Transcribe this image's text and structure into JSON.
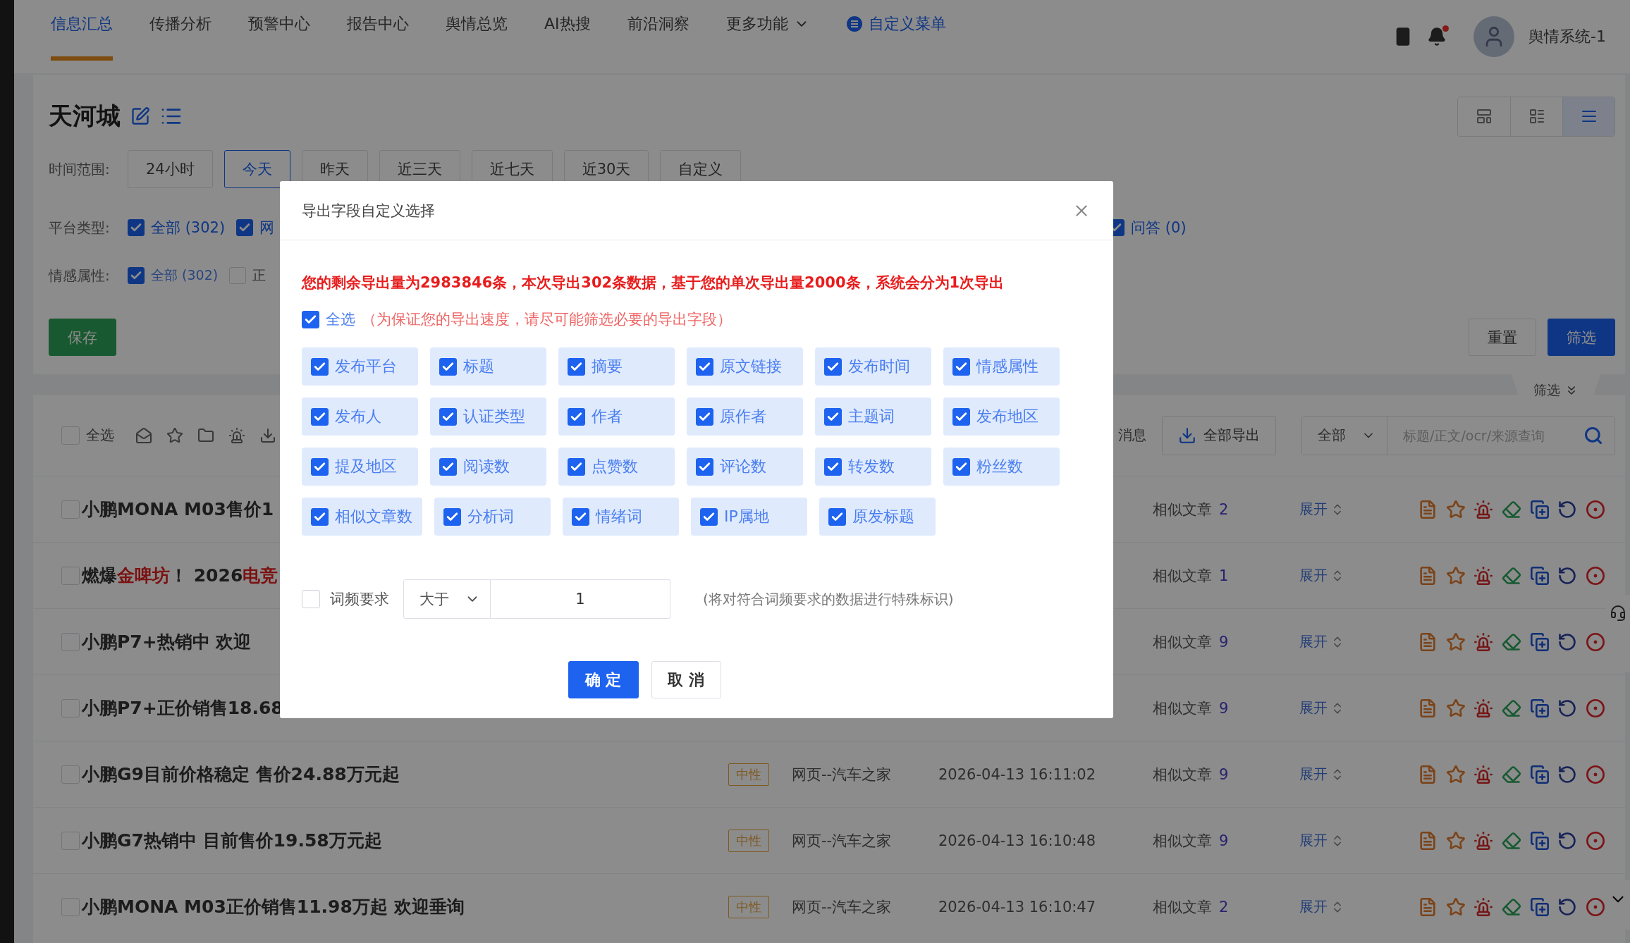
{
  "nav": {
    "items": [
      {
        "label": "信息汇总",
        "selected": true,
        "kind": "plain"
      },
      {
        "label": "传播分析",
        "selected": false,
        "kind": "plain"
      },
      {
        "label": "预警中心",
        "selected": false,
        "kind": "plain"
      },
      {
        "label": "报告中心",
        "selected": false,
        "kind": "plain"
      },
      {
        "label": "舆情总览",
        "selected": false,
        "kind": "plain"
      },
      {
        "label": "AI热搜",
        "selected": false,
        "kind": "plain"
      },
      {
        "label": "前沿洞察",
        "selected": false,
        "kind": "plain"
      },
      {
        "label": "更多功能",
        "selected": false,
        "kind": "dropdown"
      },
      {
        "label": "自定义菜单",
        "selected": false,
        "kind": "custom"
      }
    ],
    "notifications": {
      "unread": true
    },
    "user": {
      "name": "舆情系统-1"
    }
  },
  "header": {
    "title": "天河城",
    "views": [
      {
        "selected": false
      },
      {
        "selected": false
      },
      {
        "selected": true
      }
    ]
  },
  "time_range": {
    "label": "时间范围:",
    "options": [
      {
        "label": "24小时",
        "selected": false
      },
      {
        "label": "今天",
        "selected": true
      },
      {
        "label": "昨天",
        "selected": false
      },
      {
        "label": "近三天",
        "selected": false
      },
      {
        "label": "近七天",
        "selected": false
      },
      {
        "label": "近30天",
        "selected": false
      },
      {
        "label": "自定义",
        "selected": false
      }
    ]
  },
  "platform": {
    "label": "平台类型:",
    "items": [
      {
        "label": "全部 (302)",
        "checked": true
      },
      {
        "label": "网",
        "checked": true
      },
      {
        "label": "问答 (0)",
        "checked": true
      }
    ]
  },
  "sentiment": {
    "label": "情感属性:",
    "items": [
      {
        "label": "全部 (302)",
        "checked": true
      },
      {
        "label": "正",
        "checked": false
      }
    ]
  },
  "actions": {
    "save": "保存",
    "reset": "重置",
    "filter": "筛选"
  },
  "collapse_tab": {
    "label": "筛选"
  },
  "list_toolbar": {
    "select_all": {
      "label": "全选",
      "checked": false
    },
    "message": "消息",
    "export_all": "全部导出",
    "scope": {
      "value": "全部"
    },
    "search": {
      "placeholder": "标题/正文/ocr/来源查询"
    }
  },
  "rows": [
    {
      "checked": false,
      "title_parts": [
        {
          "text": "小鹏MONA M03售价1",
          "highlight": false
        }
      ],
      "similar_label": "相似文章",
      "similar_count": "2",
      "expand": "展开"
    },
    {
      "checked": false,
      "title_parts": [
        {
          "text": "燃爆",
          "highlight": false
        },
        {
          "text": "金啤坊",
          "highlight": true
        },
        {
          "text": "！ 2026",
          "highlight": false
        },
        {
          "text": "电竞",
          "highlight": true
        }
      ],
      "similar_label": "相似文章",
      "similar_count": "1",
      "expand": "展开"
    },
    {
      "checked": false,
      "title_parts": [
        {
          "text": "小鹏P7+热销中 欢迎",
          "highlight": false
        }
      ],
      "similar_label": "相似文章",
      "similar_count": "9",
      "expand": "展开"
    },
    {
      "checked": false,
      "title_parts": [
        {
          "text": "小鹏P7+正价销售18.68",
          "highlight": false
        }
      ],
      "similar_label": "相似文章",
      "similar_count": "9",
      "expand": "展开"
    },
    {
      "checked": false,
      "title_parts": [
        {
          "text": "小鹏G9目前价格稳定 售价24.88万元起",
          "highlight": false
        }
      ],
      "tag": "中性",
      "source": "网页--汽车之家",
      "time": "2026-04-13 16:11:02",
      "similar_label": "相似文章",
      "similar_count": "9",
      "expand": "展开"
    },
    {
      "checked": false,
      "title_parts": [
        {
          "text": "小鹏G7热销中 目前售价19.58万元起",
          "highlight": false
        }
      ],
      "tag": "中性",
      "source": "网页--汽车之家",
      "time": "2026-04-13 16:10:48",
      "similar_label": "相似文章",
      "similar_count": "9",
      "expand": "展开"
    },
    {
      "checked": false,
      "title_parts": [
        {
          "text": "小鹏MONA M03正价销售11.98万起 欢迎垂询",
          "highlight": false
        }
      ],
      "tag": "中性",
      "source": "网页--汽车之家",
      "time": "2026-04-13 16:10:47",
      "similar_label": "相似文章",
      "similar_count": "2",
      "expand": "展开"
    }
  ],
  "modal": {
    "title": "导出字段自定义选择",
    "warning": "您的剩余导出量为2983846条，本次导出302条数据，基于您的单次导出量2000条，系统会分为1次导出",
    "select_all": {
      "label": "全选",
      "checked": true,
      "hint": "（为保证您的导出速度，请尽可能筛选必要的导出字段）"
    },
    "fields": [
      {
        "label": "发布平台",
        "checked": true
      },
      {
        "label": "标题",
        "checked": true
      },
      {
        "label": "摘要",
        "checked": true
      },
      {
        "label": "原文链接",
        "checked": true
      },
      {
        "label": "发布时间",
        "checked": true
      },
      {
        "label": "情感属性",
        "checked": true
      },
      {
        "label": "发布人",
        "checked": true
      },
      {
        "label": "认证类型",
        "checked": true
      },
      {
        "label": "作者",
        "checked": true
      },
      {
        "label": "原作者",
        "checked": true
      },
      {
        "label": "主题词",
        "checked": true
      },
      {
        "label": "发布地区",
        "checked": true
      },
      {
        "label": "提及地区",
        "checked": true
      },
      {
        "label": "阅读数",
        "checked": true
      },
      {
        "label": "点赞数",
        "checked": true
      },
      {
        "label": "评论数",
        "checked": true
      },
      {
        "label": "转发数",
        "checked": true
      },
      {
        "label": "粉丝数",
        "checked": true
      },
      {
        "label": "相似文章数",
        "checked": true
      },
      {
        "label": "分析词",
        "checked": true
      },
      {
        "label": "情绪词",
        "checked": true
      },
      {
        "label": "IP属地",
        "checked": true
      },
      {
        "label": "原发标题",
        "checked": true
      }
    ],
    "frequency": {
      "label": "词频要求",
      "checked": false,
      "operator": "大于",
      "value": "1",
      "hint": "(将对符合词频要求的数据进行特殊标识)"
    },
    "confirm": "确 定",
    "cancel": "取 消"
  }
}
